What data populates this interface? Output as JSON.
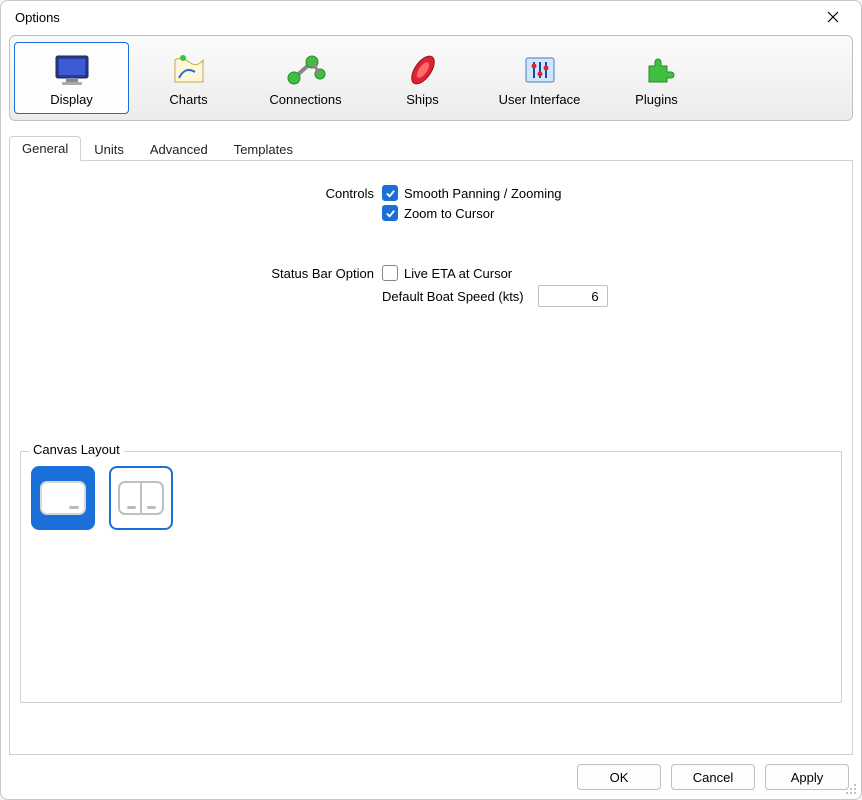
{
  "window": {
    "title": "Options"
  },
  "categories": [
    {
      "id": "display",
      "label": "Display",
      "selected": true
    },
    {
      "id": "charts",
      "label": "Charts",
      "selected": false
    },
    {
      "id": "connections",
      "label": "Connections",
      "selected": false
    },
    {
      "id": "ships",
      "label": "Ships",
      "selected": false
    },
    {
      "id": "user-interface",
      "label": "User Interface",
      "selected": false
    },
    {
      "id": "plugins",
      "label": "Plugins",
      "selected": false
    }
  ],
  "tabs": [
    {
      "id": "general",
      "label": "General",
      "active": true
    },
    {
      "id": "units",
      "label": "Units",
      "active": false
    },
    {
      "id": "advanced",
      "label": "Advanced",
      "active": false
    },
    {
      "id": "templates",
      "label": "Templates",
      "active": false
    }
  ],
  "controls_section": {
    "label": "Controls",
    "smooth_panning": {
      "label": "Smooth Panning / Zooming",
      "checked": true
    },
    "zoom_to_cursor": {
      "label": "Zoom to Cursor",
      "checked": true
    }
  },
  "statusbar_section": {
    "label": "Status Bar Option",
    "live_eta": {
      "label": "Live ETA at Cursor",
      "checked": false
    },
    "boat_speed": {
      "label": "Default Boat Speed (kts)",
      "value": "6"
    }
  },
  "canvas_layout": {
    "legend": "Canvas Layout",
    "options": [
      {
        "id": "single",
        "selected": true
      },
      {
        "id": "split",
        "selected": false
      }
    ]
  },
  "footer": {
    "ok": "OK",
    "cancel": "Cancel",
    "apply": "Apply"
  }
}
